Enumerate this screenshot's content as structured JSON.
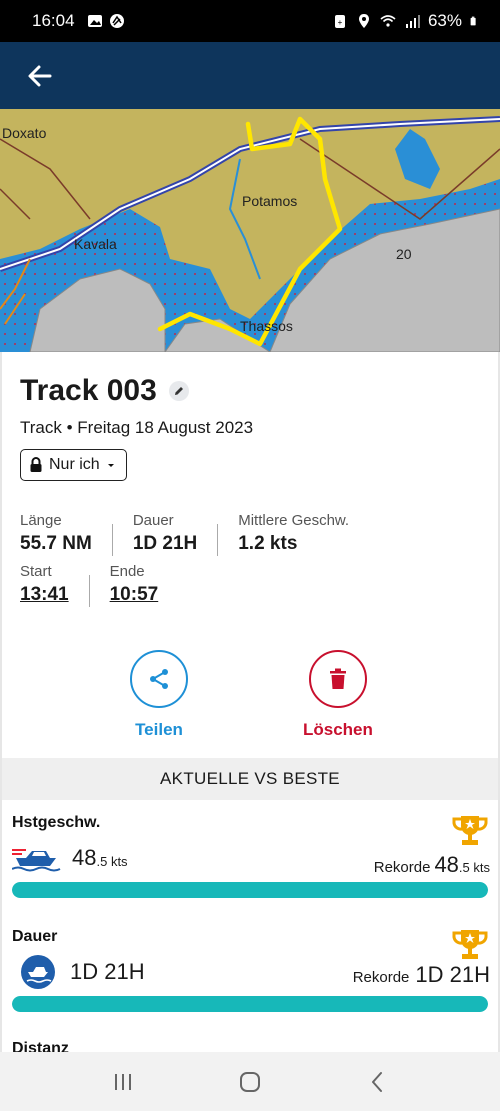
{
  "status_bar": {
    "time": "16:04",
    "battery": "63%",
    "icons": [
      "image-icon",
      "app-icon",
      "battery-saver-icon",
      "location-icon",
      "wifi-icon",
      "signal-icon",
      "battery-icon"
    ]
  },
  "app_bar": {
    "back_icon": "arrow-left-icon"
  },
  "map": {
    "labels": {
      "doxato": "Doxato",
      "kavala": "Kavala",
      "potamos": "Potamos",
      "thassos": "Thassos",
      "depth": "20"
    },
    "colors": {
      "land": "#c4b45e",
      "water": "#2a8fd6",
      "shallow": "#bdbdbd",
      "track": "#ffe600"
    }
  },
  "track": {
    "title": "Track 003",
    "subtitle": "Track • Freitag 18 August 2023",
    "privacy": "Nur ich",
    "stats": {
      "length_label": "Länge",
      "length_value": "55.7 NM",
      "duration_label": "Dauer",
      "duration_value": "1D 21H",
      "avg_speed_label": "Mittlere Geschw.",
      "avg_speed_value": "1.2 kts",
      "start_label": "Start",
      "start_value": "13:41",
      "end_label": "Ende",
      "end_value": "10:57"
    },
    "actions": {
      "share_label": "Teilen",
      "delete_label": "Löschen"
    }
  },
  "comparison": {
    "header": "AKTUELLE VS BESTE",
    "metrics": [
      {
        "title": "Hstgeschw.",
        "current_big": "48",
        "current_small": ".5 kts",
        "record_label": "Rekorde",
        "record_big": "48",
        "record_small": ".5 kts",
        "progress": 1.0
      },
      {
        "title": "Dauer",
        "current": "1D 21H",
        "record_label": "Rekorde",
        "record": "1D 21H",
        "progress": 1.0
      },
      {
        "title": "Distanz"
      }
    ]
  },
  "colors": {
    "accent_blue": "#1e90d6",
    "delete_red": "#c8102e",
    "bar_teal": "#17b8b9",
    "trophy_gold": "#f0a500",
    "app_bar": "#0e355c"
  },
  "nav": {
    "icons": [
      "recent-apps-icon",
      "home-icon",
      "back-nav-icon"
    ]
  }
}
